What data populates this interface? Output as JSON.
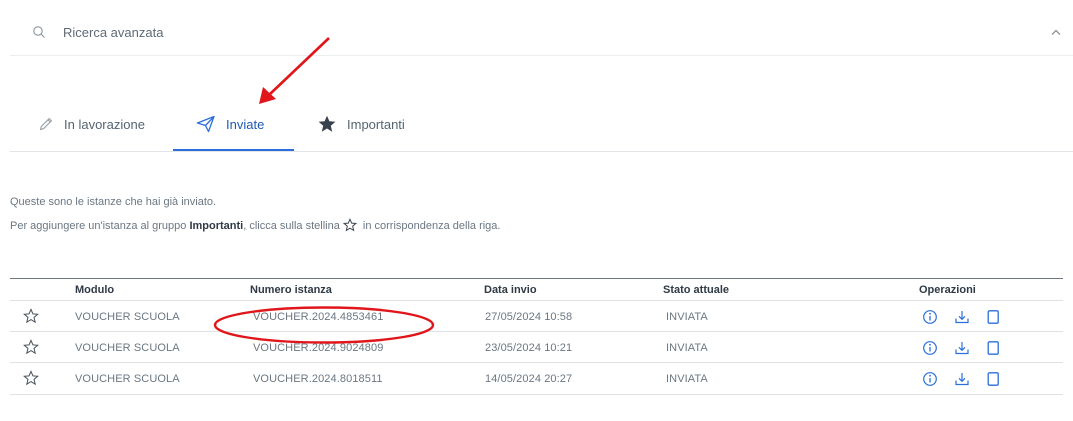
{
  "search": {
    "label": "Ricerca avanzata",
    "icon": "search-icon",
    "toggle_icon": "chevron-up-icon"
  },
  "tabs": [
    {
      "label": "In lavorazione",
      "icon": "pencil-icon",
      "active": false
    },
    {
      "label": "Inviate",
      "icon": "paper-plane-icon",
      "active": true
    },
    {
      "label": "Importanti",
      "icon": "star-filled-icon",
      "active": false
    }
  ],
  "description": {
    "line1": "Queste sono le istanze che hai già inviato.",
    "line2_before": "Per aggiungere un'istanza al gruppo ",
    "line2_bold": "Importanti",
    "line2_middle": ", clicca sulla stellina",
    "line2_after": " in corrispondenza della riga."
  },
  "table": {
    "headers": {
      "modulo": "Modulo",
      "numero": "Numero istanza",
      "data": "Data invio",
      "stato": "Stato attuale",
      "operazioni": "Operazioni"
    },
    "rows": [
      {
        "modulo": "VOUCHER SCUOLA",
        "numero": "VOUCHER.2024.4853461",
        "data": "27/05/2024 10:58",
        "stato": "INVIATA"
      },
      {
        "modulo": "VOUCHER SCUOLA",
        "numero": "VOUCHER.2024.9024809",
        "data": "23/05/2024 10:21",
        "stato": "INVIATA"
      },
      {
        "modulo": "VOUCHER SCUOLA",
        "numero": "VOUCHER.2024.8018511",
        "data": "14/05/2024 20:27",
        "stato": "INVIATA"
      }
    ],
    "operation_icons": [
      "info-icon",
      "download-icon",
      "copy-icon"
    ]
  },
  "colors": {
    "accent": "#2a6fdb",
    "annotation": "#e0161b",
    "text": "#6b7782",
    "heading": "#2f3a45"
  }
}
